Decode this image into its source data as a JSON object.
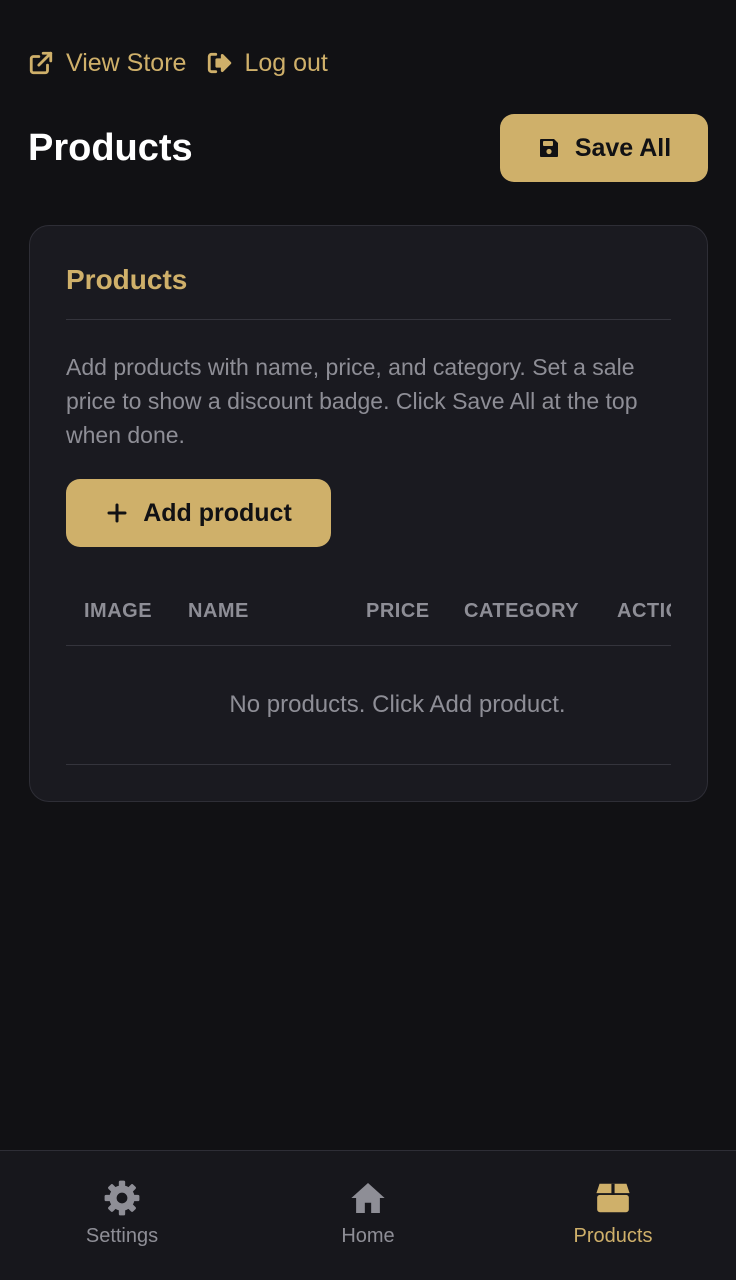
{
  "topnav": {
    "view_store": "View Store",
    "logout": "Log out"
  },
  "header": {
    "title": "Products",
    "save_label": "Save All"
  },
  "card": {
    "title": "Products",
    "description": "Add products with name, price, and category. Set a sale price to show a discount badge. Click Save All at the top when done.",
    "add_label": "Add product",
    "columns": [
      "IMAGE",
      "NAME",
      "PRICE",
      "CATEGORY",
      "ACTIONS"
    ],
    "empty_text": "No products. Click Add product."
  },
  "bottom_nav": {
    "items": [
      {
        "label": "Settings",
        "icon": "gear-icon",
        "active": false
      },
      {
        "label": "Home",
        "icon": "home-icon",
        "active": false
      },
      {
        "label": "Products",
        "icon": "box-icon",
        "active": true
      }
    ]
  },
  "colors": {
    "accent": "#cfb06a",
    "background": "#111114",
    "card": "#1a1a20",
    "muted": "#8e8e96"
  }
}
